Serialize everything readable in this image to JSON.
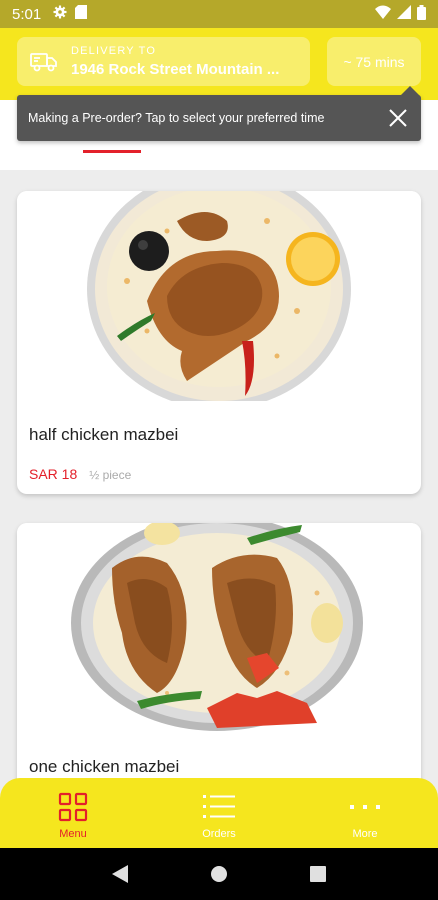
{
  "status_bar": {
    "time": "5:01",
    "icons": [
      "gear-icon",
      "sd-card-icon",
      "wifi-icon",
      "signal-icon",
      "battery-icon"
    ]
  },
  "header": {
    "delivery_label": "DELIVERY TO",
    "delivery_address": "1946 Rock Street Mountain ...",
    "eta": "~ 75 mins",
    "delivery_icon": "delivery-truck-icon"
  },
  "tooltip": {
    "text": "Making a Pre-order? Tap to select your preferred time",
    "close_icon": "close-icon"
  },
  "menu_items": [
    {
      "title": "half chicken mazbei",
      "price": "SAR 18",
      "unit": "½ piece"
    },
    {
      "title": "one chicken mazbei"
    }
  ],
  "bottom_nav": {
    "items": [
      {
        "label": "Menu",
        "icon": "grid-icon",
        "active": true
      },
      {
        "label": "Orders",
        "icon": "list-icon",
        "active": false
      },
      {
        "label": "More",
        "icon": "more-dots-icon",
        "active": false
      }
    ]
  },
  "colors": {
    "brand_yellow": "#f5e61e",
    "accent_red": "#e3202a",
    "tooltip_bg": "#555555"
  }
}
